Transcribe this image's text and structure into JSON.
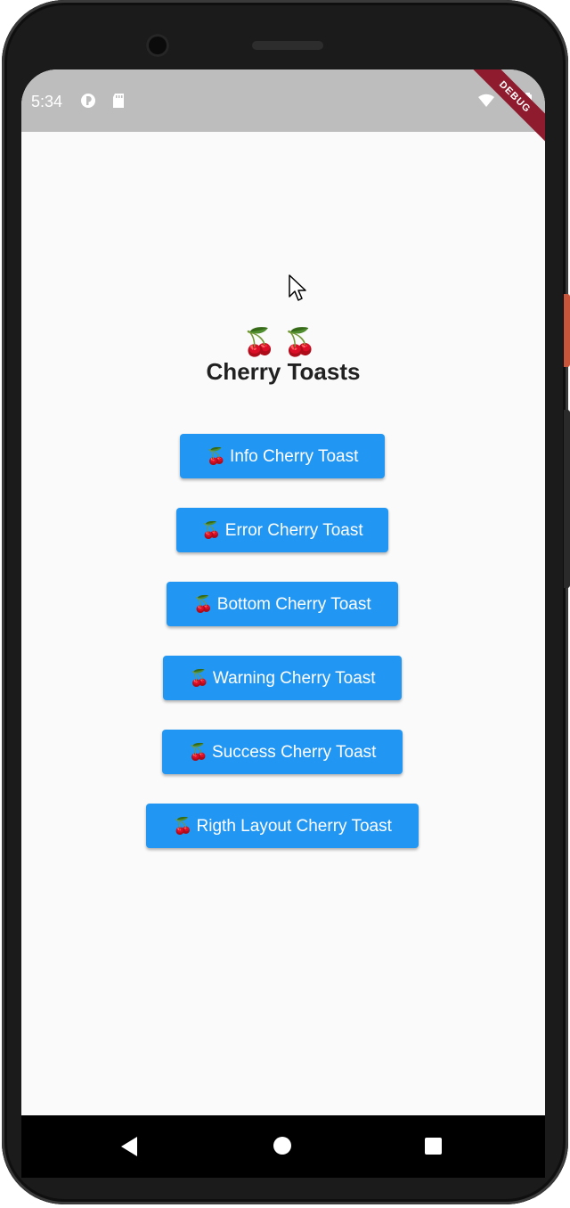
{
  "status_bar": {
    "time": "5:34",
    "icons": [
      "notification-icon",
      "sd-card-icon",
      "wifi-icon",
      "battery-icon"
    ],
    "debug_banner": "DEBUG"
  },
  "main": {
    "header_emoji": "🍒🍒",
    "title": "Cherry Toasts",
    "buttons": [
      {
        "emoji": "🍒",
        "label": "Info Cherry Toast"
      },
      {
        "emoji": "🍒",
        "label": "Error Cherry Toast"
      },
      {
        "emoji": "🍒",
        "label": "Bottom Cherry Toast"
      },
      {
        "emoji": "🍒",
        "label": "Warning Cherry Toast"
      },
      {
        "emoji": "🍒",
        "label": "Success Cherry Toast"
      },
      {
        "emoji": "🍒",
        "label": "Rigth Layout Cherry Toast"
      }
    ]
  },
  "nav_bar": {
    "icons": [
      "back-icon",
      "home-icon",
      "recents-icon"
    ]
  },
  "colors": {
    "button": "#2196f3",
    "button_text": "#ffffff",
    "title": "#212121",
    "status_bar": "#bdbdbd",
    "debug_banner": "#8e1c2e",
    "screen_background": "#fafafa"
  }
}
